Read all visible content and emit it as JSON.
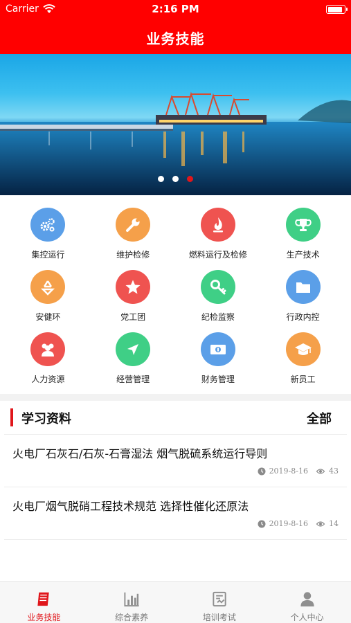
{
  "status_bar": {
    "carrier": "Carrier",
    "time": "2:16 PM"
  },
  "header": {
    "title": "业务技能"
  },
  "banner": {
    "dots": 3,
    "active_dot": 3
  },
  "grid": [
    {
      "label": "集控运行",
      "icon": "gears-icon",
      "color": "#5b9fe8"
    },
    {
      "label": "维护检修",
      "icon": "wrench-icon",
      "color": "#f5a04a"
    },
    {
      "label": "燃料运行及检修",
      "icon": "flame-icon",
      "color": "#ef5350"
    },
    {
      "label": "生产技术",
      "icon": "trophy-icon",
      "color": "#3fcf86"
    },
    {
      "label": "安健环",
      "icon": "recycle-icon",
      "color": "#f5a04a"
    },
    {
      "label": "党工团",
      "icon": "star-icon",
      "color": "#ef5350"
    },
    {
      "label": "纪检监察",
      "icon": "key-icon",
      "color": "#3fcf86"
    },
    {
      "label": "行政内控",
      "icon": "folder-icon",
      "color": "#5b9fe8"
    },
    {
      "label": "人力资源",
      "icon": "people-icon",
      "color": "#ef5350"
    },
    {
      "label": "经营管理",
      "icon": "navigation-arrow-icon",
      "color": "#3fcf86"
    },
    {
      "label": "财务管理",
      "icon": "banknote-icon",
      "color": "#5b9fe8"
    },
    {
      "label": "新员工",
      "icon": "graduation-cap-icon",
      "color": "#f5a04a"
    }
  ],
  "study": {
    "title": "学习资料",
    "all_label": "全部",
    "articles": [
      {
        "title": "火电厂石灰石/石灰-石膏湿法 烟气脱硫系统运行导则",
        "date": "2019-8-16",
        "views": "43"
      },
      {
        "title": "火电厂烟气脱硝工程技术规范 选择性催化还原法",
        "date": "2019-8-16",
        "views": "14"
      }
    ]
  },
  "tabs": [
    {
      "label": "业务技能",
      "icon": "book-icon",
      "active": true
    },
    {
      "label": "综合素养",
      "icon": "bar-chart-icon",
      "active": false
    },
    {
      "label": "培训考试",
      "icon": "exam-icon",
      "active": false
    },
    {
      "label": "个人中心",
      "icon": "person-icon",
      "active": false
    }
  ],
  "colors": {
    "brand_red": "#ff0000",
    "accent_red": "#e0161b"
  }
}
